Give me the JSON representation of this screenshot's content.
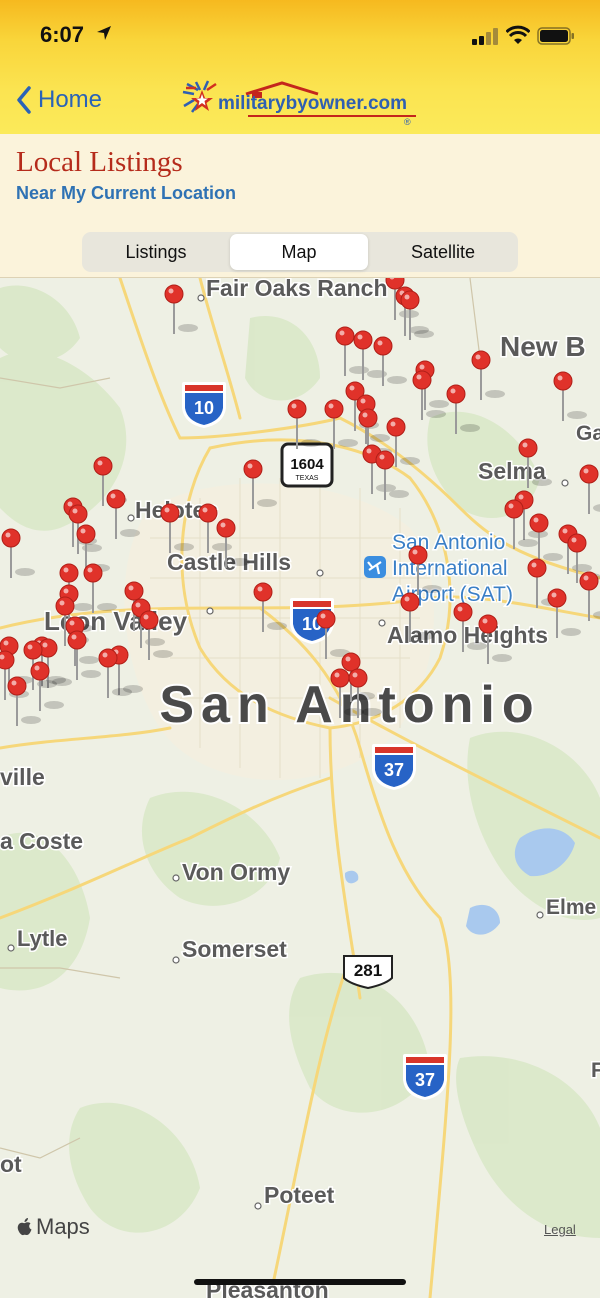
{
  "status_bar": {
    "time": "6:07"
  },
  "nav": {
    "back_label": "Home",
    "logo_text": "militarybyowner.com",
    "logo_mark": "®"
  },
  "section": {
    "title": "Local Listings",
    "subtitle": "Near My Current Location"
  },
  "view_tabs": [
    {
      "label": "Listings",
      "active": false
    },
    {
      "label": "Map",
      "active": true
    },
    {
      "label": "Satellite",
      "active": false
    }
  ],
  "map": {
    "city_label": "San Antonio",
    "labels": {
      "fair_oaks": "Fair Oaks Ranch",
      "new_b": "New B",
      "ga": "Ga",
      "selma": "Selma",
      "helotes": "Helotes",
      "castle_hills": "Castle Hills",
      "airport": [
        "San Antonio",
        "International",
        "Airport (SAT)"
      ],
      "leon_valley": "Leon Valley",
      "alamo_heights": "Alamo Heights",
      "oville": "ville",
      "la_coste": "a Coste",
      "von_ormy": "Von Ormy",
      "elme": "Elme",
      "lytle": "Lytle",
      "somerset": "Somerset",
      "ot": "ot",
      "poteet": "Poteet",
      "pleasanton": "Pleasanton",
      "f": "F"
    },
    "shields": {
      "i10_north": "10",
      "i10_center": "10",
      "loop1604": "1604",
      "loop1604_state": "TEXAS",
      "i37_center": "37",
      "us281": "281",
      "i37_south": "37"
    },
    "attribution": "Maps",
    "legal": "Legal"
  },
  "colors": {
    "pin": "#e0322a",
    "accent": "#2a63b7",
    "title": "#b52b1b"
  }
}
